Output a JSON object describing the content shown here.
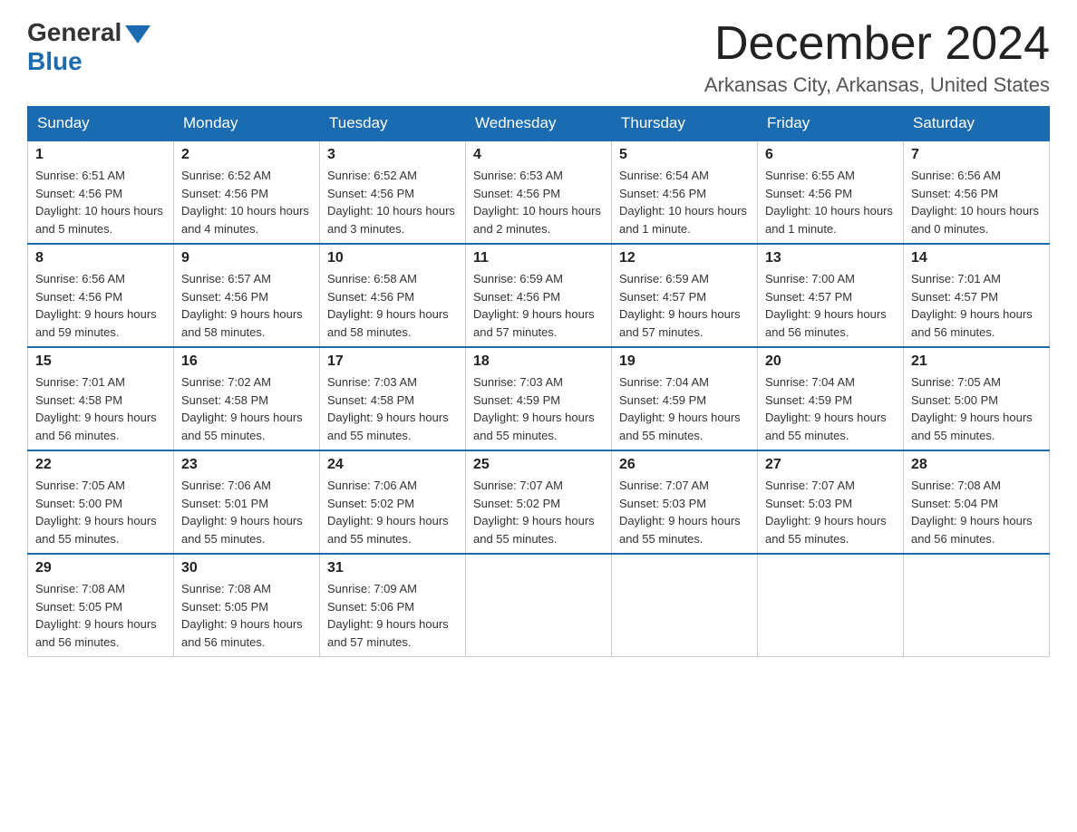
{
  "header": {
    "logo_general": "General",
    "logo_blue": "Blue",
    "month_title": "December 2024",
    "location": "Arkansas City, Arkansas, United States"
  },
  "days_of_week": [
    "Sunday",
    "Monday",
    "Tuesday",
    "Wednesday",
    "Thursday",
    "Friday",
    "Saturday"
  ],
  "weeks": [
    [
      {
        "day": "1",
        "sunrise": "6:51 AM",
        "sunset": "4:56 PM",
        "daylight": "10 hours and 5 minutes."
      },
      {
        "day": "2",
        "sunrise": "6:52 AM",
        "sunset": "4:56 PM",
        "daylight": "10 hours and 4 minutes."
      },
      {
        "day": "3",
        "sunrise": "6:52 AM",
        "sunset": "4:56 PM",
        "daylight": "10 hours and 3 minutes."
      },
      {
        "day": "4",
        "sunrise": "6:53 AM",
        "sunset": "4:56 PM",
        "daylight": "10 hours and 2 minutes."
      },
      {
        "day": "5",
        "sunrise": "6:54 AM",
        "sunset": "4:56 PM",
        "daylight": "10 hours and 1 minute."
      },
      {
        "day": "6",
        "sunrise": "6:55 AM",
        "sunset": "4:56 PM",
        "daylight": "10 hours and 1 minute."
      },
      {
        "day": "7",
        "sunrise": "6:56 AM",
        "sunset": "4:56 PM",
        "daylight": "10 hours and 0 minutes."
      }
    ],
    [
      {
        "day": "8",
        "sunrise": "6:56 AM",
        "sunset": "4:56 PM",
        "daylight": "9 hours and 59 minutes."
      },
      {
        "day": "9",
        "sunrise": "6:57 AM",
        "sunset": "4:56 PM",
        "daylight": "9 hours and 58 minutes."
      },
      {
        "day": "10",
        "sunrise": "6:58 AM",
        "sunset": "4:56 PM",
        "daylight": "9 hours and 58 minutes."
      },
      {
        "day": "11",
        "sunrise": "6:59 AM",
        "sunset": "4:56 PM",
        "daylight": "9 hours and 57 minutes."
      },
      {
        "day": "12",
        "sunrise": "6:59 AM",
        "sunset": "4:57 PM",
        "daylight": "9 hours and 57 minutes."
      },
      {
        "day": "13",
        "sunrise": "7:00 AM",
        "sunset": "4:57 PM",
        "daylight": "9 hours and 56 minutes."
      },
      {
        "day": "14",
        "sunrise": "7:01 AM",
        "sunset": "4:57 PM",
        "daylight": "9 hours and 56 minutes."
      }
    ],
    [
      {
        "day": "15",
        "sunrise": "7:01 AM",
        "sunset": "4:58 PM",
        "daylight": "9 hours and 56 minutes."
      },
      {
        "day": "16",
        "sunrise": "7:02 AM",
        "sunset": "4:58 PM",
        "daylight": "9 hours and 55 minutes."
      },
      {
        "day": "17",
        "sunrise": "7:03 AM",
        "sunset": "4:58 PM",
        "daylight": "9 hours and 55 minutes."
      },
      {
        "day": "18",
        "sunrise": "7:03 AM",
        "sunset": "4:59 PM",
        "daylight": "9 hours and 55 minutes."
      },
      {
        "day": "19",
        "sunrise": "7:04 AM",
        "sunset": "4:59 PM",
        "daylight": "9 hours and 55 minutes."
      },
      {
        "day": "20",
        "sunrise": "7:04 AM",
        "sunset": "4:59 PM",
        "daylight": "9 hours and 55 minutes."
      },
      {
        "day": "21",
        "sunrise": "7:05 AM",
        "sunset": "5:00 PM",
        "daylight": "9 hours and 55 minutes."
      }
    ],
    [
      {
        "day": "22",
        "sunrise": "7:05 AM",
        "sunset": "5:00 PM",
        "daylight": "9 hours and 55 minutes."
      },
      {
        "day": "23",
        "sunrise": "7:06 AM",
        "sunset": "5:01 PM",
        "daylight": "9 hours and 55 minutes."
      },
      {
        "day": "24",
        "sunrise": "7:06 AM",
        "sunset": "5:02 PM",
        "daylight": "9 hours and 55 minutes."
      },
      {
        "day": "25",
        "sunrise": "7:07 AM",
        "sunset": "5:02 PM",
        "daylight": "9 hours and 55 minutes."
      },
      {
        "day": "26",
        "sunrise": "7:07 AM",
        "sunset": "5:03 PM",
        "daylight": "9 hours and 55 minutes."
      },
      {
        "day": "27",
        "sunrise": "7:07 AM",
        "sunset": "5:03 PM",
        "daylight": "9 hours and 55 minutes."
      },
      {
        "day": "28",
        "sunrise": "7:08 AM",
        "sunset": "5:04 PM",
        "daylight": "9 hours and 56 minutes."
      }
    ],
    [
      {
        "day": "29",
        "sunrise": "7:08 AM",
        "sunset": "5:05 PM",
        "daylight": "9 hours and 56 minutes."
      },
      {
        "day": "30",
        "sunrise": "7:08 AM",
        "sunset": "5:05 PM",
        "daylight": "9 hours and 56 minutes."
      },
      {
        "day": "31",
        "sunrise": "7:09 AM",
        "sunset": "5:06 PM",
        "daylight": "9 hours and 57 minutes."
      },
      null,
      null,
      null,
      null
    ]
  ],
  "labels": {
    "sunrise": "Sunrise:",
    "sunset": "Sunset:",
    "daylight": "Daylight:"
  }
}
